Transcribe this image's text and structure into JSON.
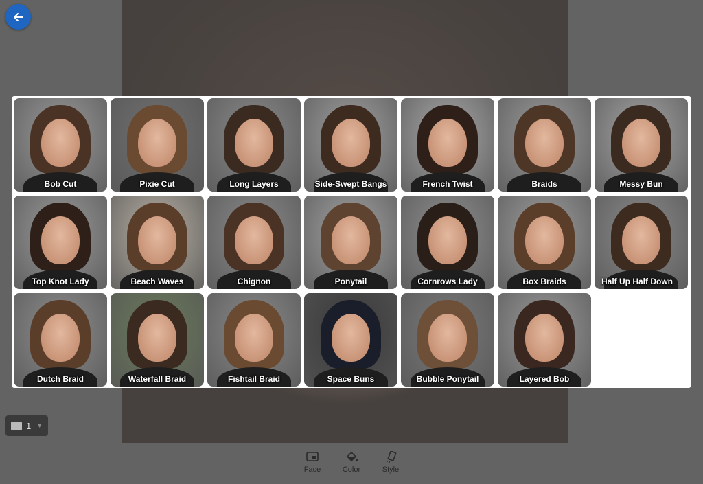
{
  "back_button": {
    "icon": "arrow-left-icon",
    "color": "#1e66c2"
  },
  "counter": {
    "value": "1",
    "icon": "image-icon"
  },
  "toolbar": {
    "face": "Face",
    "color": "Color",
    "style": "Style"
  },
  "hairstyles": [
    {
      "label": "Bob Cut",
      "hair": "#4a3325",
      "bg": "#9a9a9a"
    },
    {
      "label": "Pixie Cut",
      "hair": "#6a4a30",
      "bg": "#707070"
    },
    {
      "label": "Long Layers",
      "hair": "#3a2a20",
      "bg": "#8a8a8a"
    },
    {
      "label": "Side-Swept Bangs",
      "hair": "#3e2b20",
      "bg": "#a0a0a0"
    },
    {
      "label": "French Twist",
      "hair": "#2e2019",
      "bg": "#a8a8a8"
    },
    {
      "label": "Braids",
      "hair": "#4e3626",
      "bg": "#9c9c9c"
    },
    {
      "label": "Messy Bun",
      "hair": "#3b2a20",
      "bg": "#a5a5a5"
    },
    {
      "label": "Top Knot Lady",
      "hair": "#2e2019",
      "bg": "#9a9a9a"
    },
    {
      "label": "Beach Waves",
      "hair": "#5a3e2a",
      "bg": "#b8b0a4"
    },
    {
      "label": "Chignon",
      "hair": "#4a3325",
      "bg": "#8a8a8a"
    },
    {
      "label": "Ponytail",
      "hair": "#5e4330",
      "bg": "#a3a3a3"
    },
    {
      "label": "Cornrows Lady",
      "hair": "#2a1e18",
      "bg": "#8e8e8e"
    },
    {
      "label": "Box Braids",
      "hair": "#5a3e2a",
      "bg": "#9e9e9e"
    },
    {
      "label": "Half Up Half Down",
      "hair": "#3e2b20",
      "bg": "#8a8a8a"
    },
    {
      "label": "Dutch Braid",
      "hair": "#5a3e2a",
      "bg": "#8e8e8e"
    },
    {
      "label": "Waterfall Braid",
      "hair": "#3a2a20",
      "bg": "#6a7a5a"
    },
    {
      "label": "Fishtail Braid",
      "hair": "#6a4a30",
      "bg": "#8a8a8a"
    },
    {
      "label": "Space Buns",
      "hair": "#1a1e2a",
      "bg": "#3a3a3a"
    },
    {
      "label": "Bubble Ponytail",
      "hair": "#6e5038",
      "bg": "#7a7a7a"
    },
    {
      "label": "Layered Bob",
      "hair": "#3a2820",
      "bg": "#9a9a9a"
    }
  ]
}
